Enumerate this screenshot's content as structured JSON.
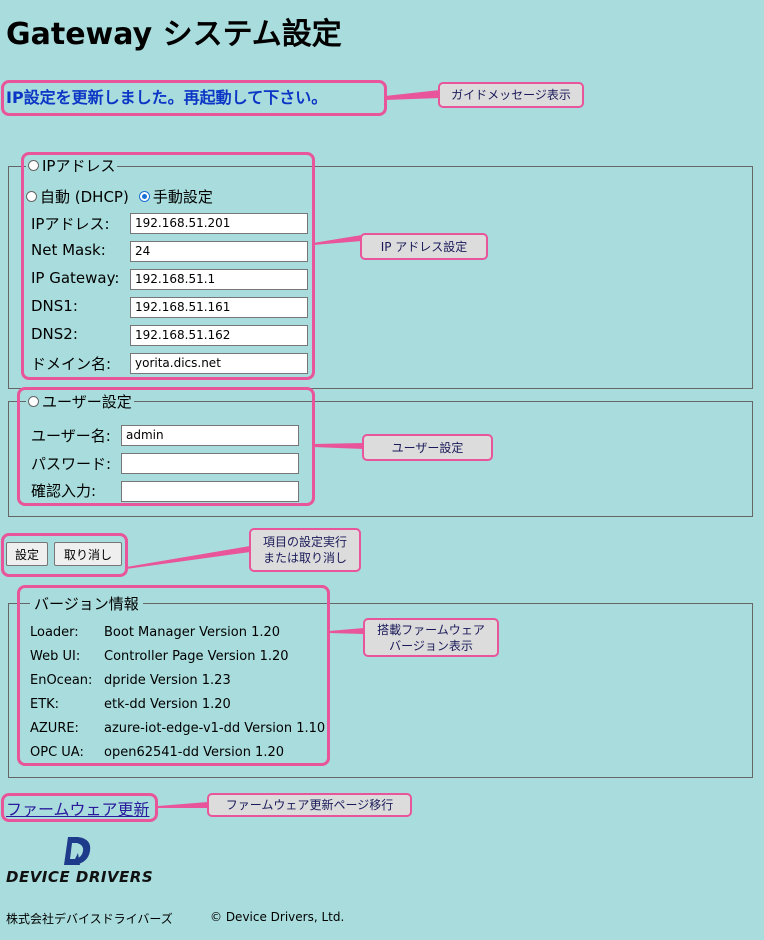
{
  "page_title": "Gateway システム設定",
  "guide_message": "IP設定を更新しました。再起動して下さい。",
  "ip_section": {
    "legend": "IPアドレス",
    "mode_auto": "自動 (DHCP)",
    "mode_manual": "手動設定",
    "fields": [
      {
        "label": "IPアドレス:",
        "value": "192.168.51.201"
      },
      {
        "label": "Net Mask:",
        "value": "24"
      },
      {
        "label": "IP Gateway:",
        "value": "192.168.51.1"
      },
      {
        "label": "DNS1:",
        "value": "192.168.51.161"
      },
      {
        "label": "DNS2:",
        "value": "192.168.51.162"
      },
      {
        "label": "ドメイン名:",
        "value": "yorita.dics.net"
      }
    ]
  },
  "user_section": {
    "legend": "ユーザー設定",
    "fields": [
      {
        "label": "ユーザー名:",
        "value": "admin"
      },
      {
        "label": "パスワード:",
        "value": ""
      },
      {
        "label": "確認入力:",
        "value": ""
      }
    ]
  },
  "buttons": {
    "apply": "設定",
    "cancel": "取り消し"
  },
  "version_section": {
    "legend": "バージョン情報",
    "rows": [
      {
        "name": "Loader:",
        "value": "Boot Manager Version 1.20"
      },
      {
        "name": "Web UI:",
        "value": "Controller Page Version 1.20"
      },
      {
        "name": "EnOcean:",
        "value": "dpride Version 1.23"
      },
      {
        "name": "ETK:",
        "value": "etk-dd Version 1.20"
      },
      {
        "name": "AZURE:",
        "value": "azure-iot-edge-v1-dd Version 1.10"
      },
      {
        "name": "OPC UA:",
        "value": "open62541-dd Version 1.20"
      }
    ]
  },
  "firmware_link": "ファームウェア更新",
  "logo_text": "DEVICE DRIVERS",
  "footer": {
    "company": "株式会社デバイスドライバーズ",
    "copyright": "© Device Drivers, Ltd."
  },
  "callouts": {
    "guide": "ガイドメッセージ表示",
    "ip": "IP アドレス設定",
    "user": "ユーザー設定",
    "buttons_line1": "項目の設定実行",
    "buttons_line2": "または取り消し",
    "version_line1": "搭載ファームウェア",
    "version_line2": "バージョン表示",
    "firmware": "ファームウェア更新ページ移行"
  },
  "colors": {
    "background": "#a9dcdc",
    "highlight": "#e8559a",
    "guide_text": "#0b36c6"
  }
}
